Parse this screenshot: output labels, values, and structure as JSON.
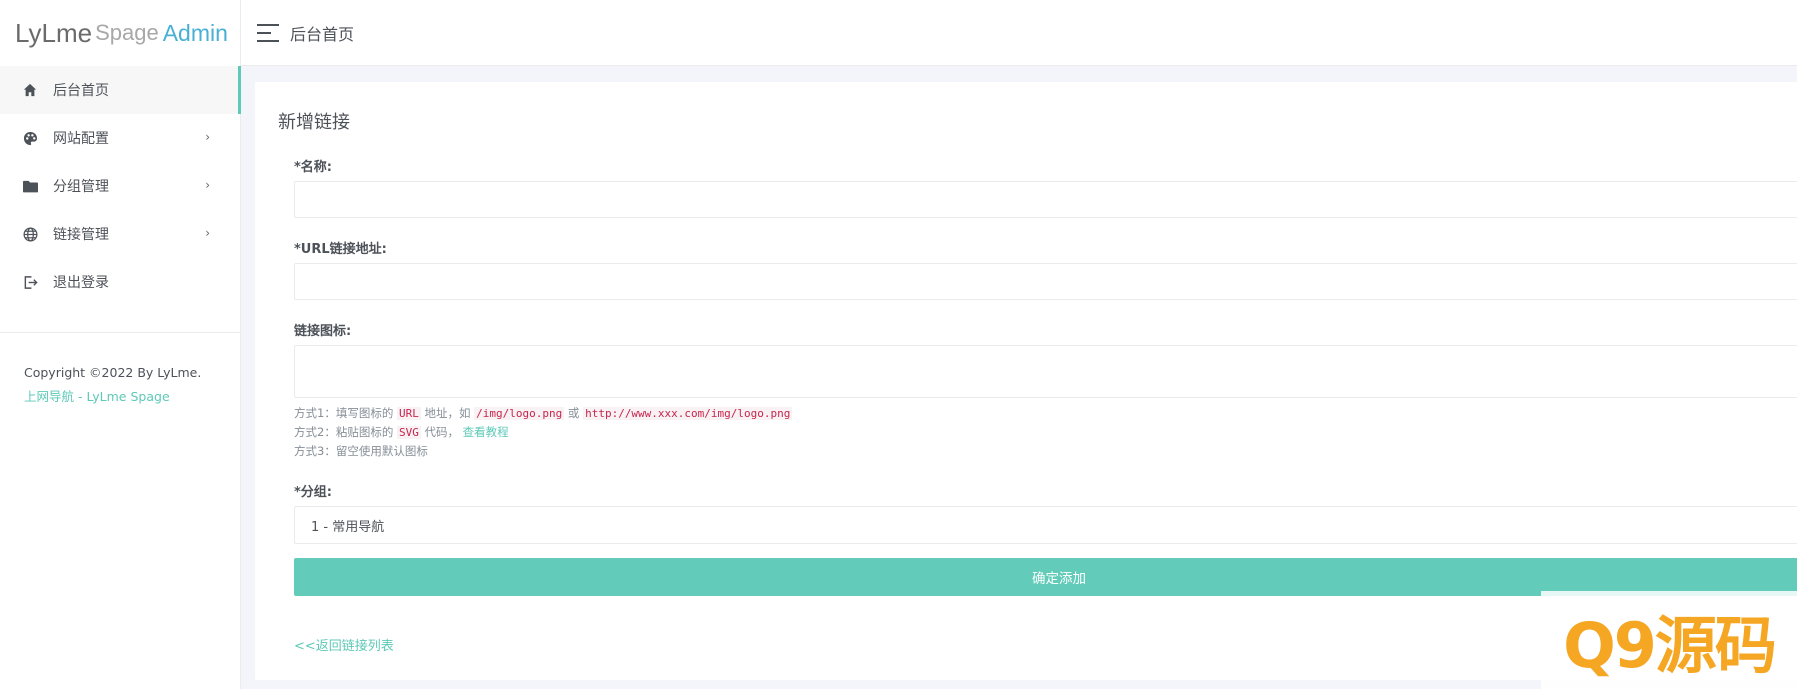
{
  "brand": {
    "part1": "LyLme",
    "part2": "Spage",
    "part3": "Admin"
  },
  "sidebar": {
    "items": [
      {
        "label": "后台首页",
        "icon": "home-icon",
        "active": true
      },
      {
        "label": "网站配置",
        "icon": "palette-icon",
        "has_arrow": true
      },
      {
        "label": "分组管理",
        "icon": "folder-icon",
        "has_arrow": true
      },
      {
        "label": "链接管理",
        "icon": "globe-icon",
        "has_arrow": true
      },
      {
        "label": "退出登录",
        "icon": "logout-icon"
      }
    ],
    "arrow": "›",
    "copyright": "Copyright ©2022 By LyLme.",
    "copyright_link": "上网导航 - LyLme Spage"
  },
  "header": {
    "title": "后台首页"
  },
  "card": {
    "title": "新增链接",
    "name_label": "*名称:",
    "url_label": "*URL链接地址:",
    "icon_label": "链接图标:",
    "help": {
      "way1_prefix": "方式1：填写图标的",
      "way1_code1": "URL",
      "way1_mid": "地址，如",
      "way1_code2": "/img/logo.png",
      "way1_or": "或",
      "way1_code3": "http://www.xxx.com/img/logo.png",
      "way2_prefix": "方式2：粘贴图标的",
      "way2_code": "SVG",
      "way2_mid": "代码，",
      "way2_link": "查看教程",
      "way3": "方式3：留空使用默认图标"
    },
    "group_label": "*分组:",
    "group_value": "1 - 常用导航",
    "submit": "确定添加",
    "back_link": "<<返回链接列表"
  },
  "watermark": {
    "text": "Q9源码"
  },
  "colors": {
    "accent": "#5ec9b7",
    "button": "#62cbb9",
    "logo_admin": "#48b0d5"
  }
}
